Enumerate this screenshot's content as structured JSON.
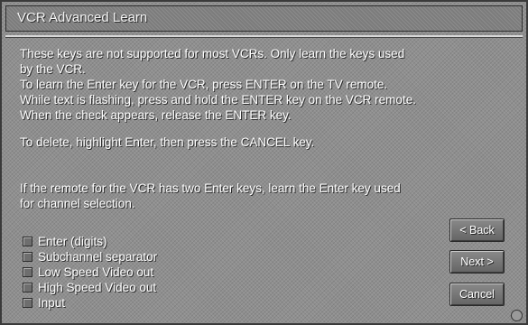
{
  "window": {
    "title": "VCR Advanced Learn"
  },
  "instructions": {
    "para1": [
      "These keys are not supported for most VCRs. Only learn the keys used",
      "by the VCR.",
      "To learn the Enter key for the VCR, press ENTER on the TV remote.",
      "While text is flashing, press and hold the ENTER key on the VCR remote.",
      "When the check appears, release the ENTER key."
    ],
    "para2": "To delete, highlight Enter, then press the CANCEL key.",
    "para3": [
      "If the remote for the VCR has two Enter keys, learn the Enter key used",
      "for channel selection."
    ]
  },
  "keys": [
    {
      "label": "Enter (digits)"
    },
    {
      "label": "Subchannel separator"
    },
    {
      "label": "Low Speed Video out"
    },
    {
      "label": "High Speed Video out"
    },
    {
      "label": "Input"
    }
  ],
  "buttons": {
    "back": "< Back",
    "next": "Next >",
    "cancel": "Cancel"
  }
}
